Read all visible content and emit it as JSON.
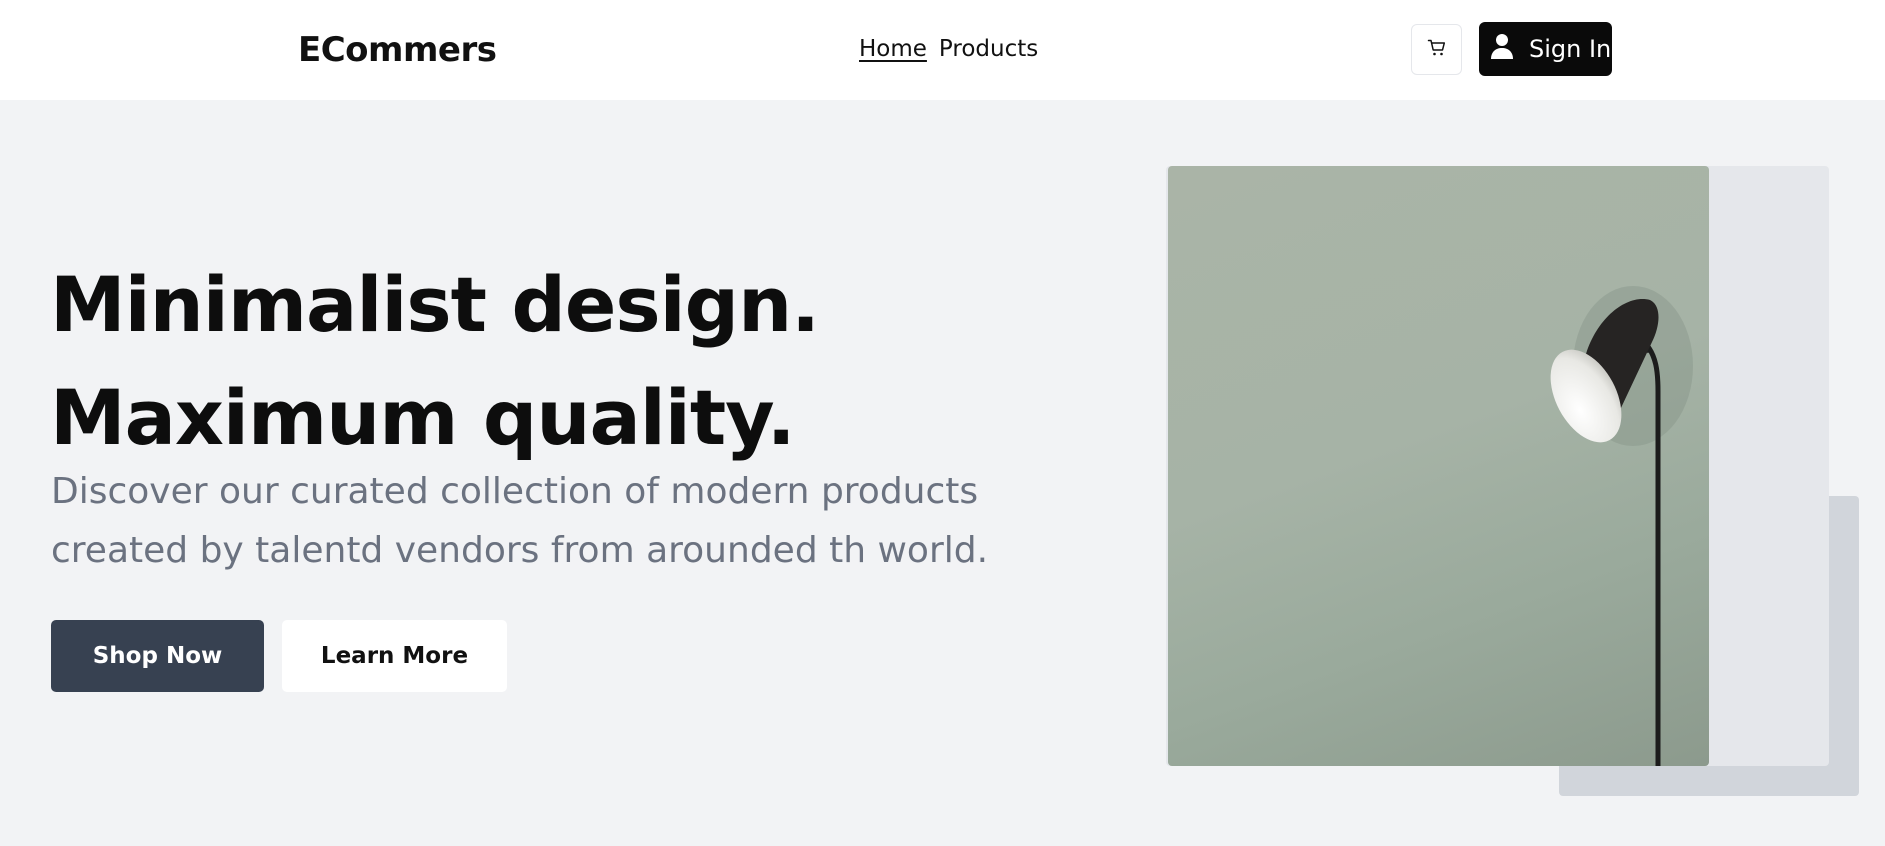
{
  "header": {
    "brand": "ECommers",
    "nav": [
      {
        "label": "Home",
        "active": true
      },
      {
        "label": "Products",
        "active": false
      }
    ],
    "cart_icon": "cart-icon",
    "signin_label": "Sign In",
    "signin_icon": "user-icon"
  },
  "hero": {
    "title_line1": "Minimalist design.",
    "title_line2": "Maximum quality.",
    "subtitle": "Discover our curated collection of modern products created by talentd vendors from arounded th world.",
    "primary_button": "Shop Now",
    "secondary_button": "Learn More",
    "image_subject": "floor lamp on sage green wall"
  },
  "colors": {
    "primary_button_bg": "#374151",
    "signin_bg": "#0a0a0a",
    "page_bg": "#f2f3f5",
    "subtitle": "#6b7280"
  }
}
